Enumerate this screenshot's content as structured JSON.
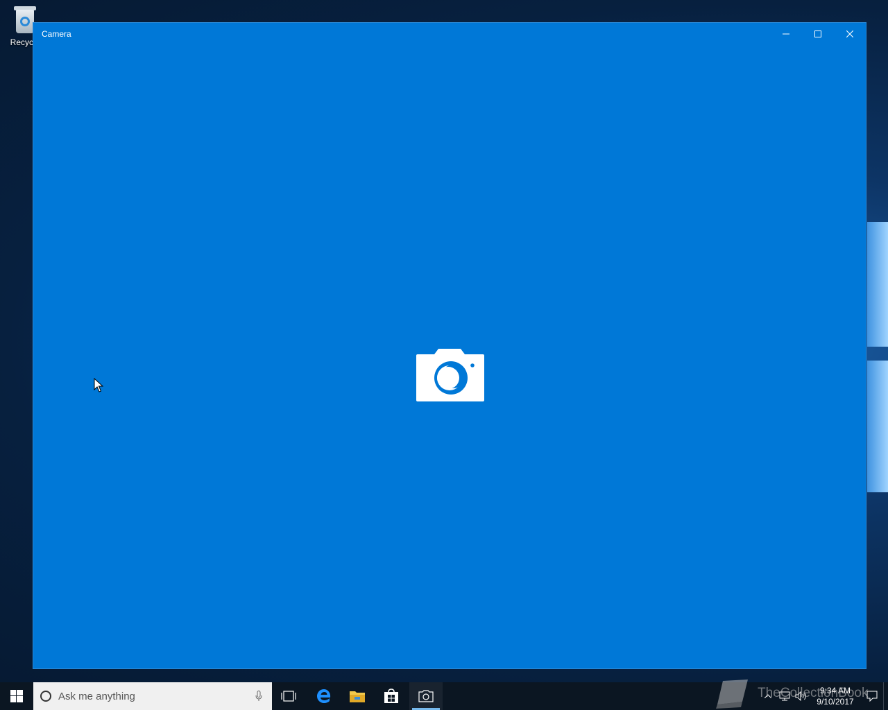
{
  "desktop": {
    "recycle_bin_label": "Recycle"
  },
  "window": {
    "title": "Camera",
    "controls": {
      "minimize": "minimize-icon",
      "maximize": "maximize-icon",
      "close": "close-icon"
    },
    "background_color": "#0078d7",
    "content_icon": "camera-icon"
  },
  "taskbar": {
    "search_placeholder": "Ask me anything",
    "pinned": [
      "task-view-icon",
      "edge-icon",
      "file-explorer-icon",
      "store-icon",
      "camera-icon"
    ],
    "clock": {
      "time": "9:34 AM",
      "date": "9/10/2017"
    }
  },
  "watermark": {
    "text": "TheCollectionBook"
  }
}
